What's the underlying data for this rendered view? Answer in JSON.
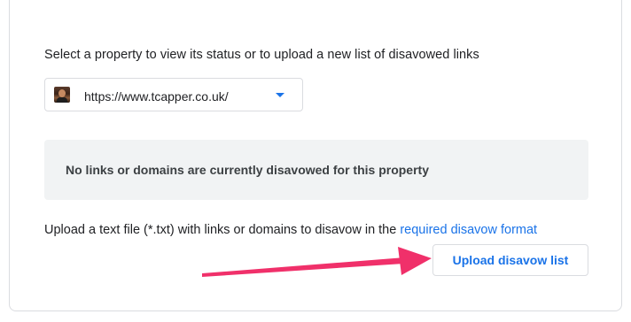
{
  "property": {
    "prompt": "Select a property to view its status or to upload a new list of disavowed links",
    "selected_url": "https://www.tcapper.co.uk/"
  },
  "notice": {
    "text": "No links or domains are currently disavowed for this property"
  },
  "upload": {
    "hint": "Upload a text file (*.txt) with links or domains to disavow in the ",
    "format_link": "required disavow format",
    "button_label": "Upload disavow list"
  },
  "colors": {
    "accent": "#1a73e8",
    "annotation_arrow": "#f0306a",
    "notice_bg": "#f1f3f4",
    "border": "#dadce0"
  },
  "icons": {
    "favicon": "site-favicon-icon",
    "dropdown": "chevron-down-icon"
  }
}
